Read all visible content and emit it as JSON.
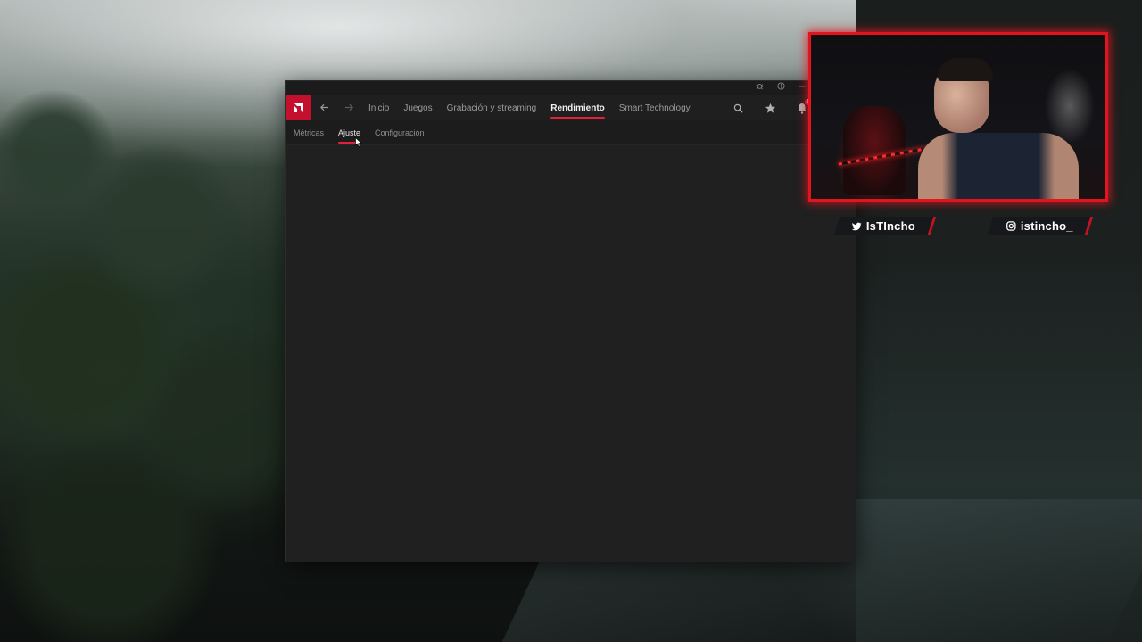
{
  "app": {
    "nav": {
      "back_icon": "arrow-left-icon",
      "forward_icon": "arrow-right-icon",
      "tabs": [
        {
          "label": "Inicio"
        },
        {
          "label": "Juegos"
        },
        {
          "label": "Grabación y streaming"
        },
        {
          "label": "Rendimiento",
          "active": true
        },
        {
          "label": "Smart Technology"
        }
      ],
      "notification_count": "1"
    },
    "subnav": {
      "tabs": [
        {
          "label": "Métricas"
        },
        {
          "label": "Ajuste",
          "active": true
        },
        {
          "label": "Configuración"
        }
      ]
    },
    "colors": {
      "accent": "#e0203c",
      "brand": "#c4102e",
      "background": "#202020"
    }
  },
  "overlay": {
    "twitter": {
      "handle": "IsTIncho",
      "icon": "twitter-icon"
    },
    "instagram": {
      "handle": "istincho_",
      "icon": "instagram-icon"
    },
    "frame_color": "#e2141e"
  }
}
